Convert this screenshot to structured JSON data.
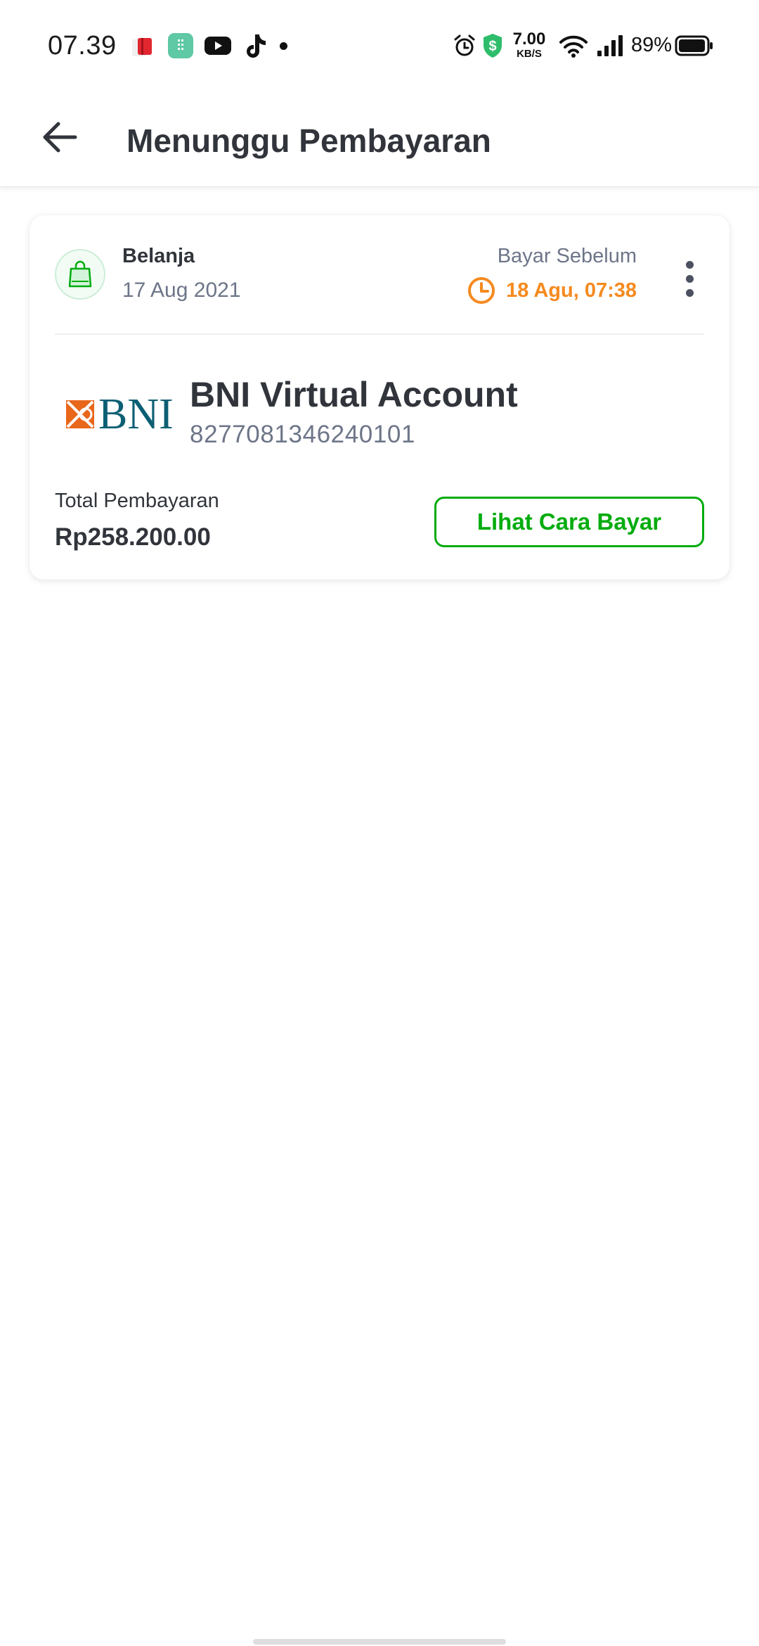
{
  "status_bar": {
    "time": "07.39",
    "network_speed_value": "7.00",
    "network_speed_unit": "KB/S",
    "battery_percent": "89%",
    "icons": [
      "notification-app-icon",
      "calculator-app-icon",
      "youtube-icon",
      "tiktok-icon",
      "more-notifications-dot",
      "alarm-icon",
      "security-shield-icon",
      "wifi-icon",
      "signal-icon",
      "battery-icon"
    ]
  },
  "header": {
    "title": "Menunggu Pembayaran",
    "back_icon": "arrow-left-icon"
  },
  "payment": {
    "category": "Belanja",
    "order_date": "17 Aug 2021",
    "deadline_label": "Bayar Sebelum",
    "deadline_value": "18 Agu, 07:38",
    "bank_logo_text": "BNI",
    "method_name": "BNI Virtual Account",
    "virtual_account_number": "8277081346240101",
    "total_label": "Total Pembayaran",
    "total_amount": "Rp258.200.00",
    "how_to_pay_label": "Lihat Cara Bayar"
  },
  "colors": {
    "accent_green": "#03ac0e",
    "deadline_orange": "#f58a1f",
    "bni_teal": "#0c5f73",
    "bni_orange": "#e8671b",
    "text_primary": "#31353b",
    "text_secondary": "#6d7588"
  }
}
